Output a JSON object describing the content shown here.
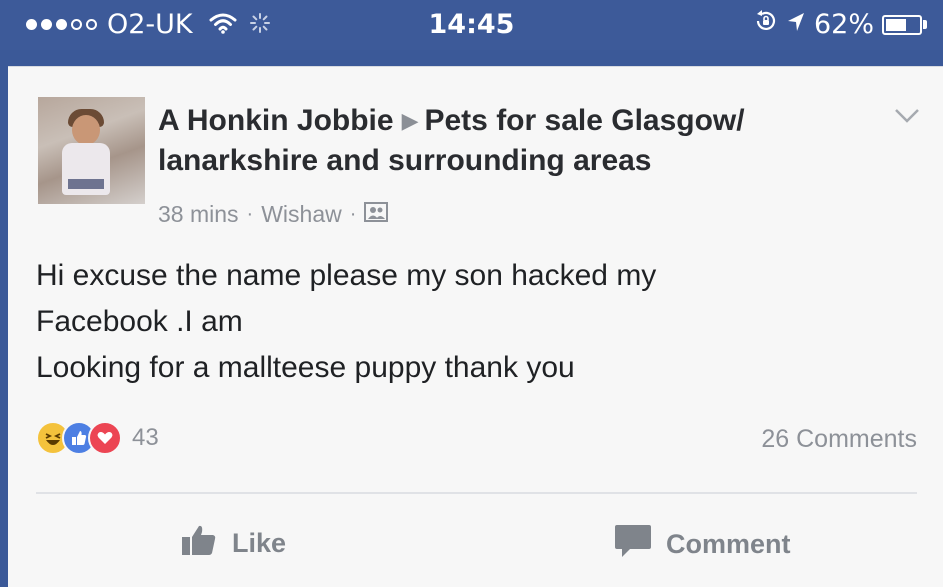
{
  "status_bar": {
    "carrier": "O2-UK",
    "time": "14:45",
    "battery": "62%",
    "battery_level": 0.62,
    "signal_bars": 3,
    "signal_total": 5,
    "icons": [
      "wifi-icon",
      "activity-icon",
      "rotation-lock-icon",
      "location-icon",
      "battery-icon"
    ]
  },
  "post": {
    "author": "A Honkin Jobbie",
    "group_line1": "Pets for sale Glasgow/",
    "group_line2": "lanarkshire and surrounding areas",
    "time_ago": "38 mins",
    "location": "Wishaw",
    "separator": "·",
    "message_lines": [
      "Hi excuse the name please my son hacked my",
      "Facebook .I am",
      "Looking for a mallteese puppy thank you"
    ],
    "reaction_icons": [
      "haha-icon",
      "like-icon",
      "love-icon"
    ],
    "reaction_count": "43",
    "comments_count": "26 Comments"
  },
  "actions": {
    "like_label": "Like",
    "comment_label": "Comment"
  },
  "colors": {
    "status_bar": "#3d5a99",
    "card_background": "#f7f7f7",
    "haha": "#f4c23c",
    "like": "#4d7fe3",
    "love": "#ec4553",
    "muted_text": "#8d9198"
  }
}
